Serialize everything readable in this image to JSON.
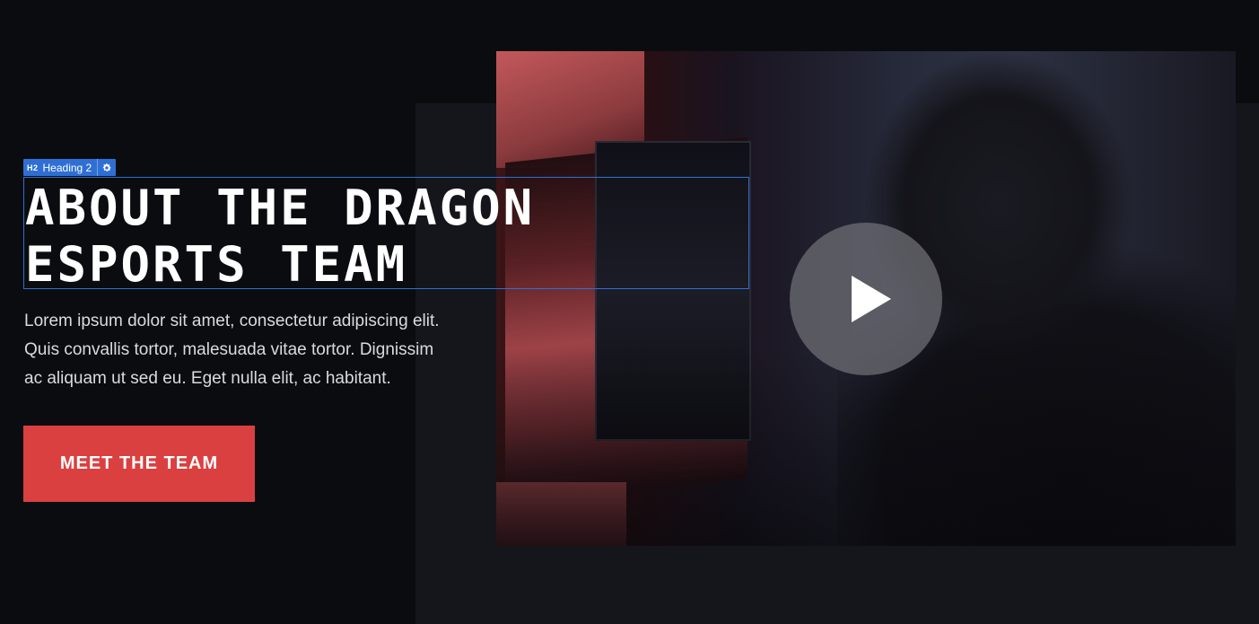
{
  "editor": {
    "tag_prefix": "H2",
    "tag_label": "Heading 2"
  },
  "hero": {
    "heading_line1": "ABOUT THE DRAGON",
    "heading_line2": "ESPORTS TEAM",
    "description_line1": "Lorem ipsum dolor sit amet, consectetur adipiscing elit.",
    "description_line2": "Quis convallis tortor, malesuada vitae tortor. Dignissim",
    "description_line3": "ac aliquam ut sed eu. Eget nulla elit, ac habitant.",
    "cta_label": "MEET THE TEAM"
  },
  "media": {
    "play_icon": "play-icon",
    "image_icon": "video-thumbnail"
  },
  "colors": {
    "background": "#0b0c10",
    "panel": "#15161b",
    "accent": "#db4040",
    "editor_blue": "#2f6fd3"
  }
}
